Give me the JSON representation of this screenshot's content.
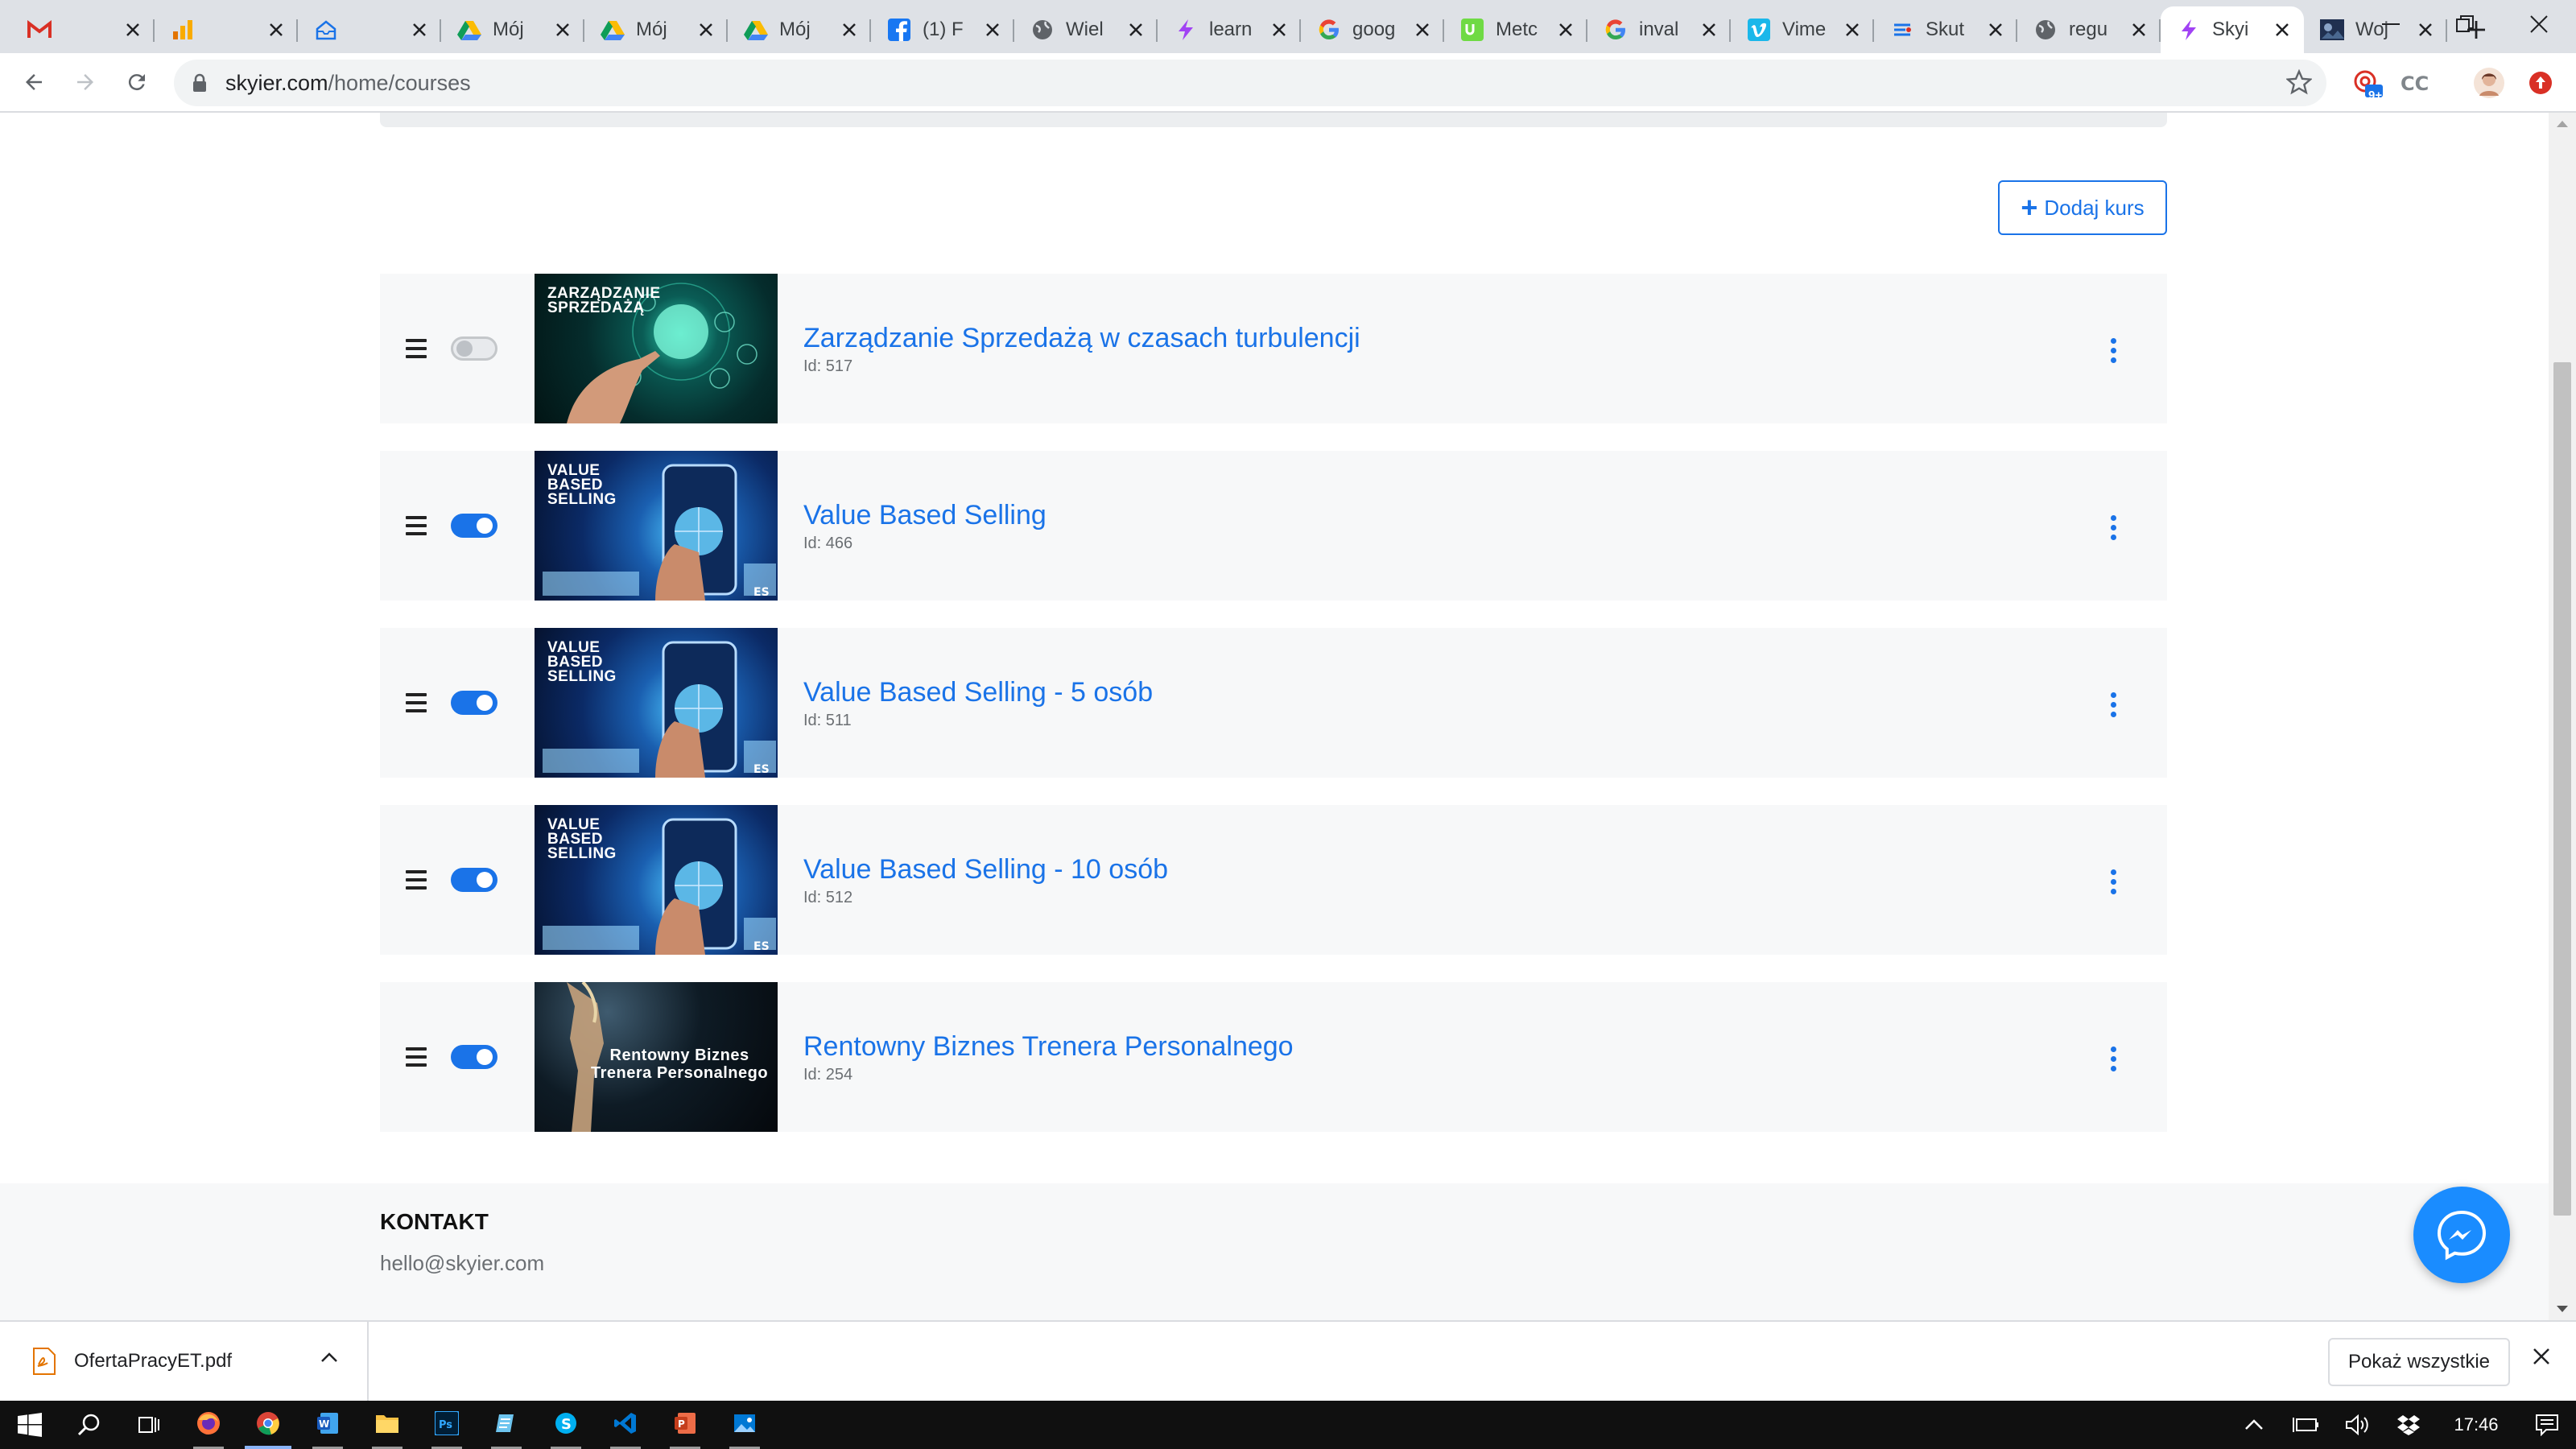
{
  "browser": {
    "tabs": [
      {
        "title": "",
        "icon": "gmail-icon",
        "color": "#d93025"
      },
      {
        "title": "",
        "icon": "analytics-icon",
        "color": "#f9ab00"
      },
      {
        "title": "",
        "icon": "inbox-icon",
        "color": "#1a73e8"
      },
      {
        "title": "Mój",
        "icon": "google-drive-icon",
        "color": "#0f9d58"
      },
      {
        "title": "Mój",
        "icon": "google-drive-icon",
        "color": "#0f9d58"
      },
      {
        "title": "Mój",
        "icon": "google-drive-icon",
        "color": "#0f9d58"
      },
      {
        "title": "(1) F",
        "icon": "facebook-icon",
        "color": "#1877f2"
      },
      {
        "title": "Wiel",
        "icon": "globe-icon",
        "color": "#5f6368"
      },
      {
        "title": "learn",
        "icon": "skyier-icon",
        "color": "#a142f4"
      },
      {
        "title": "goog",
        "icon": "google-icon",
        "color": "#4285f4"
      },
      {
        "title": "Metc",
        "icon": "upwork-icon",
        "color": "#6fda44"
      },
      {
        "title": "inval",
        "icon": "google-icon",
        "color": "#4285f4"
      },
      {
        "title": "Vime",
        "icon": "vimeo-icon",
        "color": "#1ab7ea"
      },
      {
        "title": "Skut",
        "icon": "site-icon",
        "color": "#5f6368"
      },
      {
        "title": "regu",
        "icon": "globe-icon",
        "color": "#5f6368"
      },
      {
        "title": "Skyi",
        "icon": "skyier-icon",
        "color": "#a142f4",
        "active": true
      },
      {
        "title": "Woj",
        "icon": "site-thumb-icon",
        "color": "#203050"
      }
    ],
    "url_host": "skyier.com",
    "url_path": "/home/courses",
    "extension_badge": "9+"
  },
  "page": {
    "add_course_label": "Dodaj kurs",
    "courses": [
      {
        "title": "Zarządzanie Sprzedażą w czasach turbulencji",
        "id_label": "Id: 517",
        "enabled": false,
        "thumb_text": "ZARZĄDZANIE\nSPRZEDAŻĄ",
        "thumb_style": "t-green"
      },
      {
        "title": "Value Based Selling",
        "id_label": "Id: 466",
        "enabled": true,
        "thumb_text": "VALUE\nBASED\nSELLING",
        "thumb_style": "t-blue"
      },
      {
        "title": "Value Based Selling - 5 osób",
        "id_label": "Id: 511",
        "enabled": true,
        "thumb_text": "VALUE\nBASED\nSELLING",
        "thumb_style": "t-blue"
      },
      {
        "title": "Value Based Selling - 10 osób",
        "id_label": "Id: 512",
        "enabled": true,
        "thumb_text": "VALUE\nBASED\nSELLING",
        "thumb_style": "t-blue"
      },
      {
        "title": "Rentowny Biznes Trenera Personalnego",
        "id_label": "Id: 254",
        "enabled": true,
        "thumb_text": "Rentowny Biznes\nTrenera Personalnego",
        "thumb_style": "t-dark"
      }
    ],
    "footer": {
      "heading": "KONTAKT",
      "email": "hello@skyier.com"
    }
  },
  "downloads": {
    "file_name": "OfertaPracyET.pdf",
    "show_all_label": "Pokaż wszystkie"
  },
  "taskbar": {
    "clock": "17:46",
    "apps": [
      "firefox-icon",
      "chrome-icon",
      "word-icon",
      "file-explorer-icon",
      "photoshop-icon",
      "notepad-icon",
      "skype-icon",
      "vscode-icon",
      "powerpoint-icon",
      "photos-icon"
    ]
  },
  "colors": {
    "accent": "#1a73e8",
    "row_bg": "#f7f8f9"
  }
}
